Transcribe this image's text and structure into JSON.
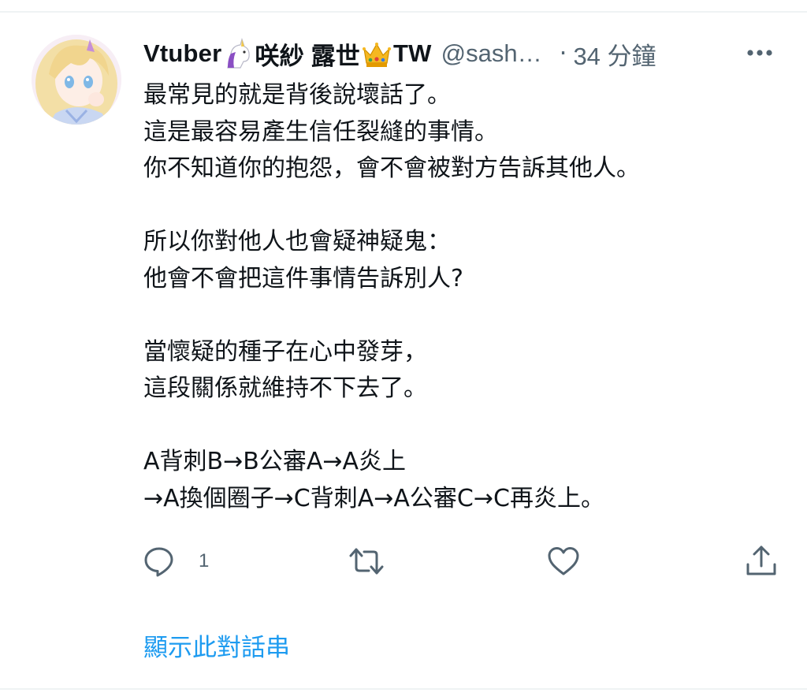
{
  "tweet": {
    "author": {
      "display_name_part1": "Vtuber",
      "emoji1": "unicorn-emoji",
      "display_name_part2": "咲紗 露世",
      "emoji2": "crown-emoji",
      "display_name_part3": "TW",
      "handle": "@sash…"
    },
    "separator": "·",
    "timestamp": "34 分鐘",
    "text_lines": [
      "最常見的就是背後說壞話了。",
      "這是最容易產生信任裂縫的事情。",
      "你不知道你的抱怨，會不會被對方告訴其他人。",
      "",
      "所以你對他人也會疑神疑鬼：",
      "他會不會把這件事情告訴別人?",
      "",
      "當懷疑的種子在心中發芽，",
      "這段關係就維持不下去了。",
      "",
      "A背刺B→B公審A→A炎上",
      "→A換個圈子→C背刺A→A公審C→C再炎上。"
    ],
    "actions": {
      "reply_count": "1",
      "reply_icon": "reply-icon",
      "retweet_icon": "retweet-icon",
      "like_icon": "heart-icon",
      "share_icon": "share-icon"
    },
    "show_thread_label": "顯示此對話串"
  },
  "colors": {
    "text_primary": "#0f1419",
    "text_secondary": "#536471",
    "link": "#1d9bf0",
    "divider": "#eff3f4"
  }
}
